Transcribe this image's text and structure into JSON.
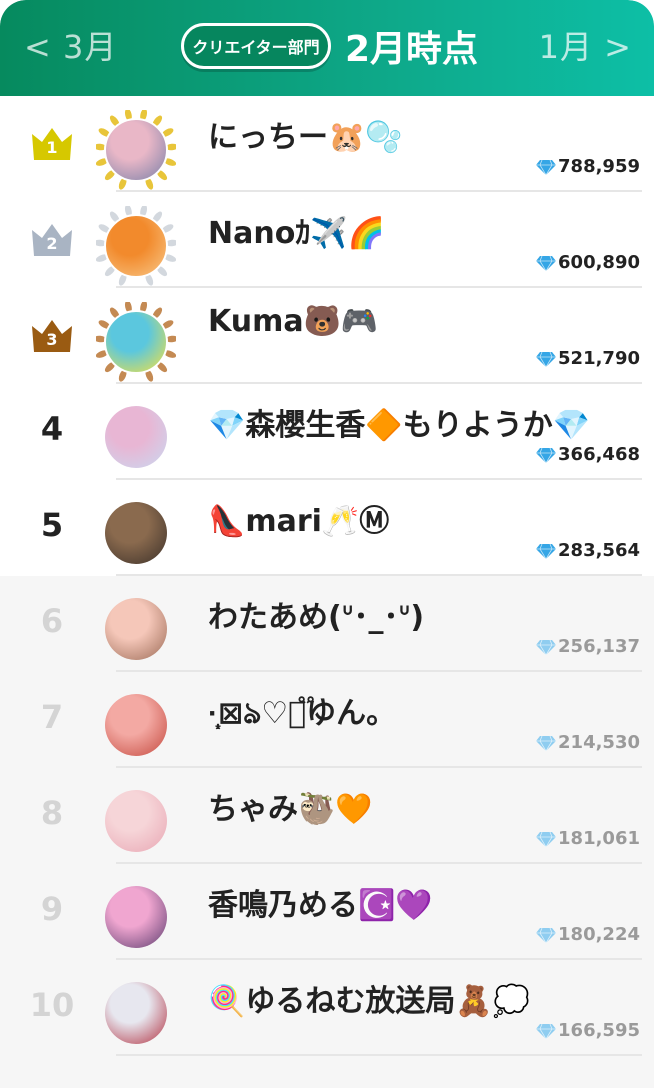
{
  "header": {
    "prev_label": "< 3月",
    "next_label": "1月 >",
    "category_label": "クリエイター部門",
    "period_label": "2月時点"
  },
  "rows": [
    {
      "rank": "1",
      "name": "にっちー🐹🫧",
      "score": "788,959",
      "crown_color": "#d6c800",
      "avatar_colors": [
        "#e9b7c7",
        "#7a7fa7"
      ],
      "wreath": "gold"
    },
    {
      "rank": "2",
      "name": "Nanoｶ✈️🌈",
      "score": "600,890",
      "crown_color": "#a9b4c3",
      "avatar_colors": [
        "#f28a2c",
        "#f8c889"
      ],
      "wreath": "silver"
    },
    {
      "rank": "3",
      "name": "Kuma🐻🎮",
      "score": "521,790",
      "crown_color": "#9a5b12",
      "avatar_colors": [
        "#5bc7de",
        "#f7e23c"
      ],
      "wreath": "bronze"
    },
    {
      "rank": "4",
      "name": "💎森櫻生香🔶もりようか💎",
      "score": "366,468",
      "avatar_colors": [
        "#e8b6d4",
        "#c9d9f1"
      ]
    },
    {
      "rank": "5",
      "name": "👠mari🥂Ⓜ",
      "score": "283,564",
      "avatar_colors": [
        "#8a6a4e",
        "#3b3029"
      ]
    },
    {
      "rank": "6",
      "name": "わたあめ(ᐡ･_･ᐡ)",
      "score": "256,137",
      "avatar_colors": [
        "#f5c7b9",
        "#9b6a55"
      ]
    },
    {
      "rank": "7",
      "name": "·̩͙⊠ঌ♡᳝֟ゆん。",
      "score": "214,530",
      "avatar_colors": [
        "#f3a9a3",
        "#c4483d"
      ]
    },
    {
      "rank": "8",
      "name": "ちゃみ🦥🧡",
      "score": "181,061",
      "avatar_colors": [
        "#f6d5d8",
        "#e8a6b3"
      ]
    },
    {
      "rank": "9",
      "name": "香鳴乃める☪️💜",
      "score": "180,224",
      "avatar_colors": [
        "#f0a6d0",
        "#5b3b6e"
      ]
    },
    {
      "rank": "10",
      "name": "🍭ゆるねむ放送局🧸💭",
      "score": "166,595",
      "avatar_colors": [
        "#e7e7ef",
        "#b13040"
      ]
    }
  ]
}
